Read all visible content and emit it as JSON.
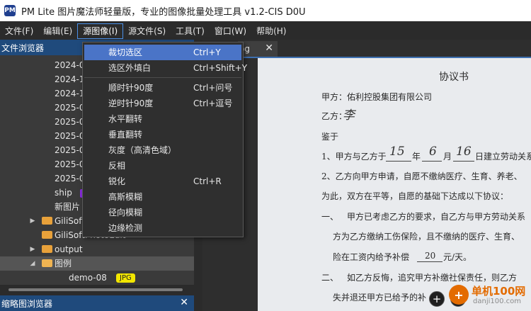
{
  "window": {
    "logo_text": "PM",
    "title": "PM Lite 图片魔法师轻量版，专业的图像批量处理工具 v1.2-CIS D0U"
  },
  "menubar": [
    {
      "label": "文件(F)"
    },
    {
      "label": "编辑(E)"
    },
    {
      "label": "源图像(I)"
    },
    {
      "label": "源文件(S)"
    },
    {
      "label": "工具(T)"
    },
    {
      "label": "窗口(W)"
    },
    {
      "label": "帮助(H)"
    }
  ],
  "file_browser": {
    "title": "文件浏览器",
    "close": "✕",
    "rows": [
      {
        "label": "2024-0"
      },
      {
        "label": "2024-1"
      },
      {
        "label": "2024-1"
      },
      {
        "label": "2025-0"
      },
      {
        "label": "2025-0"
      },
      {
        "label": "2025-0"
      },
      {
        "label": "2025-0"
      },
      {
        "label": "2025-0"
      },
      {
        "label": "2025-0"
      },
      {
        "label": "ship"
      },
      {
        "label": "新图片"
      },
      {
        "label": "GiliSoft"
      },
      {
        "label": "GiliSoftPhotoEdit"
      },
      {
        "label": "output"
      },
      {
        "label": "图例"
      },
      {
        "label": "demo-08",
        "badge": "JPG"
      }
    ]
  },
  "thumbnail_browser": {
    "title": "缩略图浏览器",
    "close": "✕"
  },
  "tab": {
    "label": "og",
    "close": "✕"
  },
  "dropdown": {
    "items": [
      {
        "label": "裁切选区",
        "shortcut": "Ctrl+Y"
      },
      {
        "label": "选区外填白",
        "shortcut": "Ctrl+Shift+Y"
      },
      {
        "label": "顺时针90度",
        "shortcut": "Ctrl+问号"
      },
      {
        "label": "逆时针90度",
        "shortcut": "Ctrl+逗号"
      },
      {
        "label": "水平翻转",
        "shortcut": ""
      },
      {
        "label": "垂直翻转",
        "shortcut": ""
      },
      {
        "label": "灰度（高清色域）",
        "shortcut": ""
      },
      {
        "label": "反相",
        "shortcut": ""
      },
      {
        "label": "锐化",
        "shortcut": "Ctrl+R"
      },
      {
        "label": "高斯模糊",
        "shortcut": ""
      },
      {
        "label": "径向模糊",
        "shortcut": ""
      },
      {
        "label": "边缘检测",
        "shortcut": ""
      }
    ]
  },
  "document": {
    "title": "协议书",
    "party_a": "甲方：佑利控股集团有限公司",
    "party_b": "乙方：",
    "party_b_sign": "李",
    "witness": "鉴于",
    "line1_a": "1、甲方与乙方于",
    "line1_y": "15",
    "line1_b": "年",
    "line1_m": "6",
    "line1_c": "月",
    "line1_d": "16",
    "line1_e": "日建立劳动关系",
    "line2": "2、乙方向甲方申请，自愿不缴纳医疗、生育、养老、",
    "line3": "为此，双方在平等，自愿的基础下达成以下协议：",
    "clause1_num": "一、",
    "clause1_a": "甲方已考虑乙方的要求，自乙方与甲方劳动关系",
    "clause1_b": "方为乙方缴纳工伤保险，且不缴纳的医疗、生育、",
    "clause1_c_pre": "险在工资内给予补偿",
    "clause1_c_amt": "20",
    "clause1_c_post": "元/天。",
    "clause2_num": "二、",
    "clause2_a": "如乙方反悔，追究甲方补缴社保责任，则乙方",
    "clause2_b": "失并退还甲方已给予的补"
  },
  "viewer": {
    "zoom_in": "+",
    "next": "›"
  },
  "watermark": {
    "symbol": "+",
    "text": "单机100网",
    "url": "danji100.com"
  },
  "colors": {
    "accent": "#4a74c7",
    "panel_header": "#1f4a7c",
    "badge": "#f2e600",
    "folder": "#e8a13a"
  }
}
